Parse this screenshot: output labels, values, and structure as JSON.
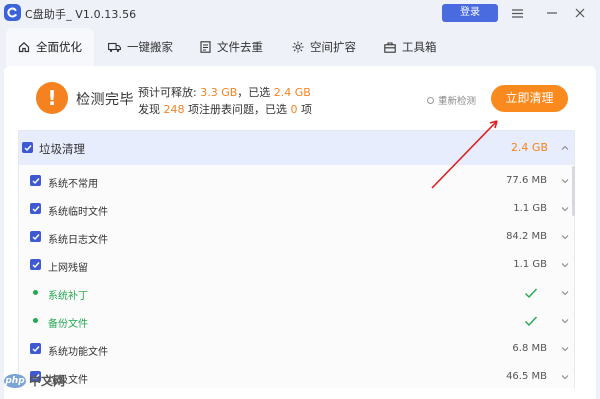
{
  "app": {
    "title": "C盘助手_ V1.0.13.56",
    "login_label": "登录"
  },
  "tabs": [
    {
      "label": "全面优化",
      "icon": "home-icon",
      "active": true
    },
    {
      "label": "一键搬家",
      "icon": "truck-icon",
      "active": false
    },
    {
      "label": "文件去重",
      "icon": "file-icon",
      "active": false
    },
    {
      "label": "空间扩容",
      "icon": "expand-icon",
      "active": false
    },
    {
      "label": "工具箱",
      "icon": "toolbox-icon",
      "active": false
    }
  ],
  "summary": {
    "status_title": "检测完毕",
    "line1_prefix": "预计可释放:",
    "line1_value": "3.3 GB",
    "line1_mid": "，已选",
    "line1_selected": "2.4 GB",
    "line2_prefix": "发现",
    "line2_value": "248",
    "line2_mid": "项注册表问题，已选",
    "line2_selected": "0",
    "line2_suffix": "项",
    "rescan_label": "重新检测",
    "clean_label": "立即清理"
  },
  "category": {
    "label": "垃圾清理",
    "size": "2.4 GB"
  },
  "items": [
    {
      "label": "系统不常用",
      "size": "77.6 MB",
      "type": "checkbox"
    },
    {
      "label": "系统临时文件",
      "size": "1.1 GB",
      "type": "checkbox"
    },
    {
      "label": "系统日志文件",
      "size": "84.2 MB",
      "type": "checkbox"
    },
    {
      "label": "上网残留",
      "size": "1.1 GB",
      "type": "checkbox"
    },
    {
      "label": "系统补丁",
      "size": "",
      "type": "ok"
    },
    {
      "label": "备份文件",
      "size": "",
      "type": "ok"
    },
    {
      "label": "系统功能文件",
      "size": "6.8 MB",
      "type": "checkbox"
    },
    {
      "label": "垃圾文件",
      "size": "46.5 MB",
      "type": "checkbox"
    }
  ],
  "watermark": {
    "logo": "php",
    "text": "中文网"
  },
  "colors": {
    "accent": "#4a6be0",
    "orange": "#fb8a1e",
    "green": "#23a84f",
    "arrow": "#e02020"
  }
}
